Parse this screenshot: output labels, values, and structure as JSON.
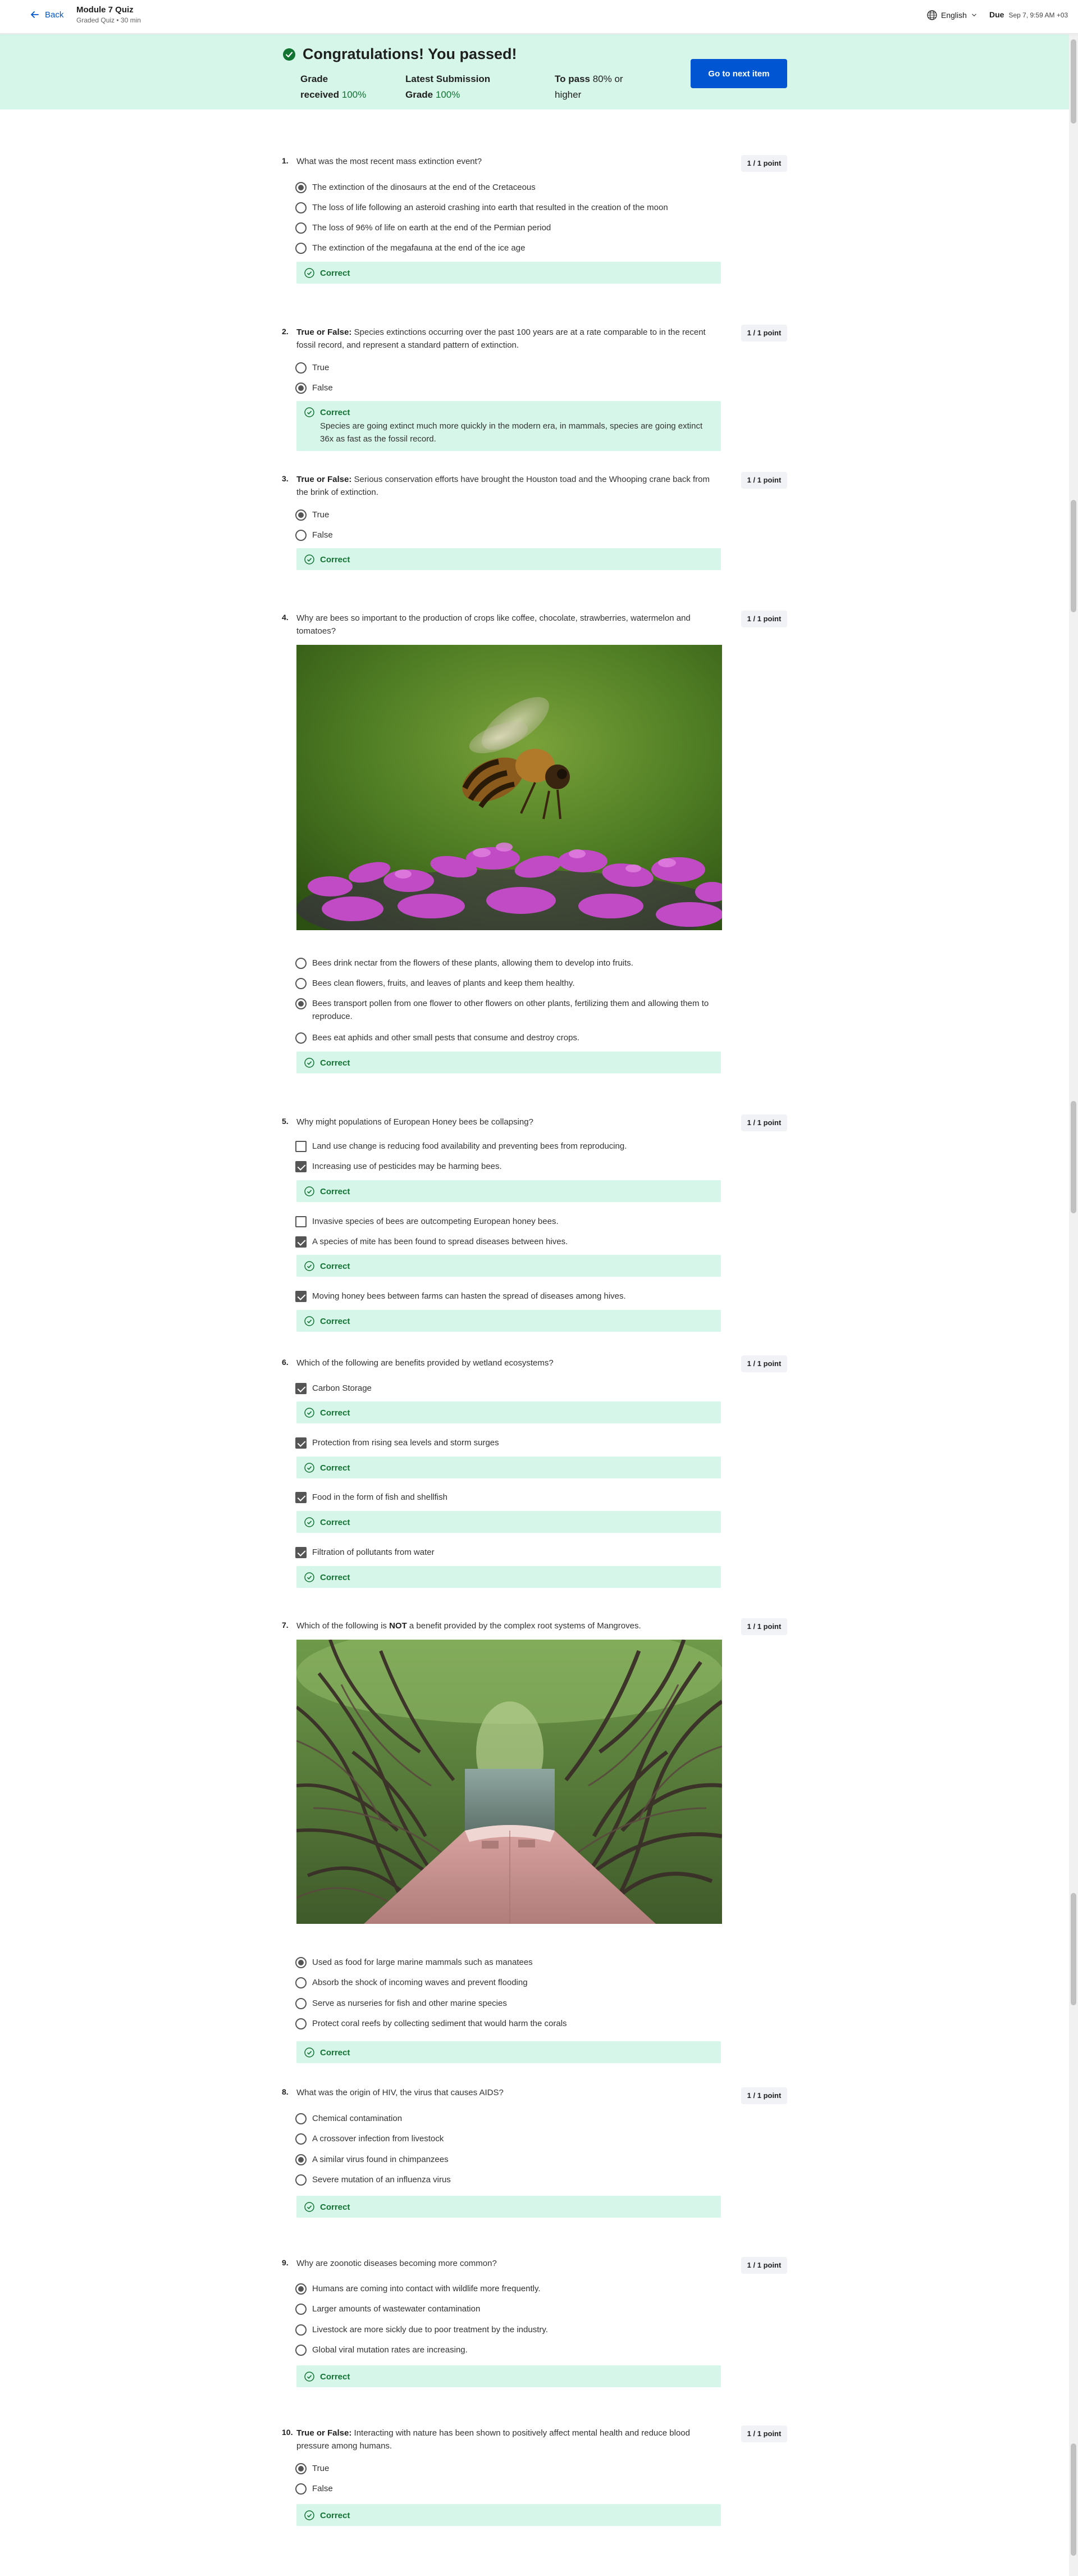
{
  "header": {
    "back_label": "Back",
    "title": "Module 7 Quiz",
    "subtitle": "Graded Quiz • 30 min",
    "language": "English",
    "due_label": "Due",
    "due_value": "Sep 7, 9:59 AM +03"
  },
  "banner": {
    "title": "Congratulations! You passed!",
    "grade_label_1": "Grade",
    "grade_label_2": "received",
    "grade_value": "100%",
    "latest_label_1": "Latest Submission",
    "latest_label_2": "Grade",
    "latest_value": "100%",
    "pass_label": "To pass",
    "pass_value": "80% or",
    "pass_suffix": "higher",
    "next_button": "Go to next item"
  },
  "points_label": "1 / 1 point",
  "correct_label": "Correct",
  "colors": {
    "accent": "#0056d2",
    "success_bg": "#d6f6ea",
    "success_text": "#137333"
  },
  "questions": [
    {
      "number": "1.",
      "text": "What was the most recent mass extinction event?",
      "options": [
        "The extinction of the dinosaurs at the end of the Cretaceous",
        "The loss of life following an asteroid crashing into earth that resulted in the creation of the moon",
        "The loss of 96% of life on earth at the end of the Permian period",
        "The extinction of the megafauna at the end of the ice age"
      ],
      "selected": 0
    },
    {
      "number": "2.",
      "prefix": "True or False:",
      "text": " Species extinctions occurring over the past 100 years are at a rate comparable to in the recent fossil record, and represent a standard pattern of extinction.",
      "options": [
        "True",
        "False"
      ],
      "selected": 1,
      "feedback": "Species are going extinct much more quickly in the modern era, in mammals, species are going extinct 36x as fast as the fossil record."
    },
    {
      "number": "3.",
      "prefix": "True or False:",
      "text": " Serious conservation efforts have brought the Houston toad and the Whooping crane back from the brink of extinction.",
      "options": [
        "True",
        "False"
      ],
      "selected": 0
    },
    {
      "number": "4.",
      "text": "Why are bees so important to the production of crops like coffee, chocolate, strawberries, watermelon and tomatoes?",
      "image": "bee-on-flower",
      "options": [
        "Bees drink nectar from the flowers of these plants, allowing them to develop into fruits.",
        "Bees clean flowers, fruits, and leaves of plants and keep them healthy.",
        "Bees transport pollen from one flower to other flowers on other plants, fertilizing them and allowing them to reproduce.",
        "Bees eat aphids and other small pests that consume and destroy crops."
      ],
      "selected": 2
    },
    {
      "number": "5.",
      "text": "Why might populations of European Honey bees be collapsing?",
      "options": [
        "Land use change is reducing food availability and preventing bees from reproducing.",
        "Increasing use of pesticides may be harming bees.",
        "Invasive species of bees are outcompeting European honey bees.",
        "A species of mite has been found to spread diseases between hives.",
        "Moving honey bees between farms can hasten the spread of diseases among hives."
      ]
    },
    {
      "number": "6.",
      "text": "Which of the following are benefits provided by wetland ecosystems?",
      "options": [
        "Carbon Storage",
        "Protection from rising sea levels and storm surges",
        "Food in the form of fish and shellfish",
        "Filtration of pollutants from water"
      ]
    },
    {
      "number": "7.",
      "text_before": "Which of the following is ",
      "text_bold": "NOT",
      "text_after": " a benefit provided by the complex root systems of Mangroves.",
      "image": "mangrove-boat",
      "options": [
        "Used as food for large marine mammals such as manatees",
        "Absorb the shock of incoming waves and prevent flooding",
        "Serve as nurseries for fish and other marine species",
        "Protect coral reefs by collecting sediment that would harm the corals"
      ],
      "selected": 0
    },
    {
      "number": "8.",
      "text": "What was the origin of HIV, the virus that causes AIDS?",
      "options": [
        "Chemical contamination",
        "A crossover infection from livestock",
        "A similar virus found in chimpanzees",
        "Severe mutation of an influenza virus"
      ],
      "selected": 2
    },
    {
      "number": "9.",
      "text": "Why are zoonotic diseases becoming more common?",
      "options": [
        "Humans are coming into contact with wildlife more frequently.",
        "Larger amounts of wastewater contamination",
        "Livestock are more sickly due to poor treatment by the industry.",
        "Global viral mutation rates are increasing."
      ],
      "selected": 0
    },
    {
      "number": "10.",
      "prefix": "True or False:",
      "text": " Interacting with nature has been shown to positively affect mental health and reduce blood pressure among humans.",
      "options": [
        "True",
        "False"
      ],
      "selected": 0
    }
  ]
}
